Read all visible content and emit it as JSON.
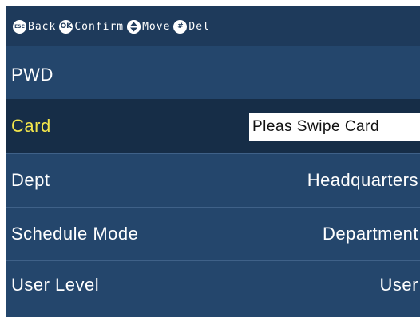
{
  "hint_bar": {
    "back": {
      "key": "ESC",
      "label": "Back"
    },
    "confirm": {
      "key": "OK",
      "label": "Confirm"
    },
    "move": {
      "icon": "up-down-icon",
      "label": "Move"
    },
    "delete": {
      "key": "#",
      "label": "Del"
    }
  },
  "fields": {
    "pwd": {
      "label": "PWD",
      "value": ""
    },
    "card": {
      "label": "Card",
      "value": "Pleas Swipe Card"
    },
    "dept": {
      "label": "Dept",
      "value": "Headquarters"
    },
    "schedule_mode": {
      "label": "Schedule Mode",
      "value": "Department"
    },
    "user_level": {
      "label": "User Level",
      "value": "User"
    }
  },
  "colors": {
    "background": "#24466c",
    "header": "#1e3a5b",
    "selected_row": "#162d47",
    "selected_label": "#f2e54b",
    "text": "#ffffff"
  }
}
